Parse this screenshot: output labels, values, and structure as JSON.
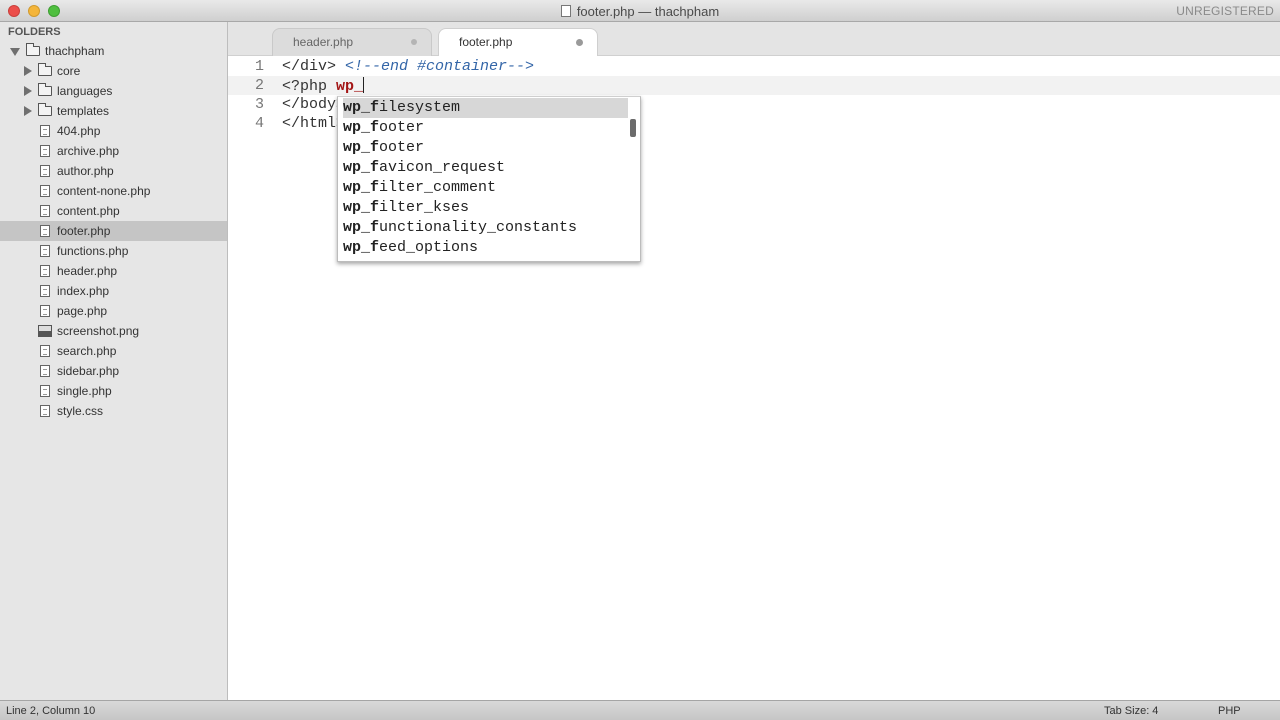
{
  "window": {
    "title": "footer.php — thachpham",
    "registration": "UNREGISTERED"
  },
  "sidebar": {
    "header": "FOLDERS",
    "project": "thachpham",
    "folders": [
      "core",
      "languages",
      "templates"
    ],
    "files": [
      "404.php",
      "archive.php",
      "author.php",
      "content-none.php",
      "content.php",
      "footer.php",
      "functions.php",
      "header.php",
      "index.php",
      "page.php",
      "screenshot.png",
      "search.php",
      "sidebar.php",
      "single.php",
      "style.css"
    ],
    "selected": "footer.php"
  },
  "tabs": [
    {
      "label": "header.php",
      "active": false
    },
    {
      "label": "footer.php",
      "active": true
    }
  ],
  "editor": {
    "line_numbers": [
      "1",
      "2",
      "3",
      "4"
    ],
    "line1_tag": "</div> ",
    "line1_comment": "<!--end #container-->",
    "line2_prefix": "<?php ",
    "line2_typed": "wp_",
    "line3": "</body>",
    "line4": "</html>"
  },
  "autocomplete": {
    "items": [
      {
        "match": "wp_f",
        "rest": "ilesystem"
      },
      {
        "match": "wp_f",
        "rest": "ooter"
      },
      {
        "match": "wp_f",
        "rest": "ooter"
      },
      {
        "match": "wp_f",
        "rest": "avicon_request"
      },
      {
        "match": "wp_f",
        "rest": "ilter_comment"
      },
      {
        "match": "wp_f",
        "rest": "ilter_kses"
      },
      {
        "match": "wp_f",
        "rest": "unctionality_constants"
      },
      {
        "match": "wp_f",
        "rest": "eed_options"
      }
    ]
  },
  "status": {
    "position": "Line 2, Column 10",
    "tab_size": "Tab Size: 4",
    "syntax": "PHP"
  }
}
